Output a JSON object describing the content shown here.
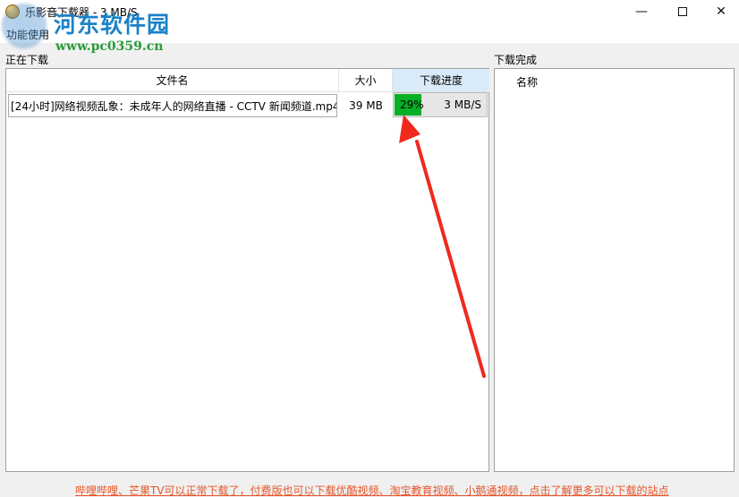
{
  "window": {
    "title": "乐影音下载器 - 3 MB/S",
    "min_glyph": "—",
    "close_glyph": "✕"
  },
  "menu": {
    "items": [
      {
        "label": "功能使用"
      }
    ]
  },
  "watermark": {
    "title": "河东软件园",
    "url": "www.pc0359.cn"
  },
  "downloading": {
    "label": "正在下载",
    "columns": [
      "文件名",
      "大小",
      "下载进度"
    ],
    "rows": [
      {
        "filename": "[24小时]网络视频乱象：未成年人的网络直播 - CCTV 新闻频道.mp4",
        "size": "39 MB",
        "progress_percent": 29,
        "progress_label": "29%",
        "speed": "3 MB/S"
      }
    ]
  },
  "completed": {
    "label": "下载完成",
    "columns": [
      "名称"
    ]
  },
  "footer": {
    "link_text": "哔哩哔哩、芒果TV可以正常下载了，付费版也可以下载优酷视频、淘宝教育视频、小鹅通视频，点击了解更多可以下载的站点"
  },
  "colors": {
    "progress_fill": "#06b025",
    "progress_header": "#d9ebf9",
    "annotation_arrow": "#f0281e",
    "footer_link": "#e8552a",
    "watermark_title": "#1a82c8",
    "watermark_url": "#2a9a3a"
  }
}
